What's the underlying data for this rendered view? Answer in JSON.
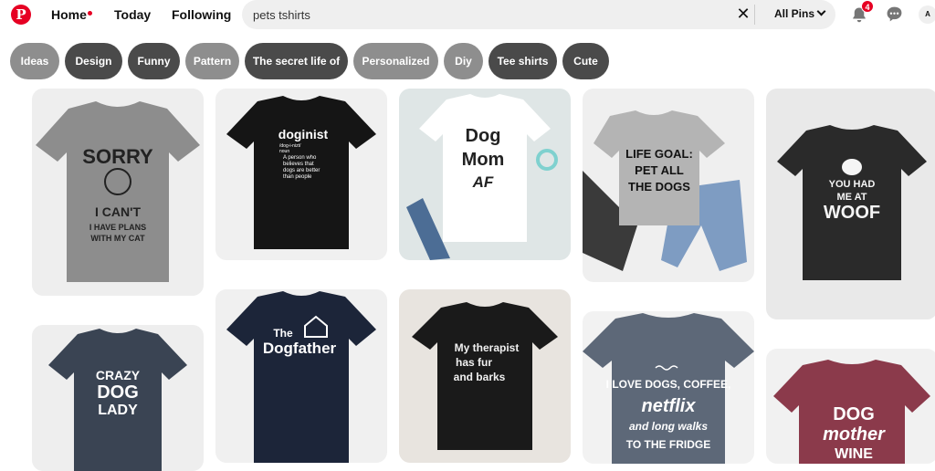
{
  "header": {
    "logo_letter": "P",
    "nav": {
      "home": "Home",
      "today": "Today",
      "following": "Following"
    },
    "search": {
      "value": "pets tshirts",
      "filter_label": "All Pins"
    },
    "notifications_count": "4",
    "avatar_letter": "A",
    "brand_color": "#e60023"
  },
  "chips": [
    {
      "label": "Ideas",
      "color": "#8e8e8e"
    },
    {
      "label": "Design",
      "color": "#4a4a4a"
    },
    {
      "label": "Funny",
      "color": "#4a4a4a"
    },
    {
      "label": "Pattern",
      "color": "#8e8e8e"
    },
    {
      "label": "The secret life of",
      "color": "#4a4a4a"
    },
    {
      "label": "Personalized",
      "color": "#8e8e8e"
    },
    {
      "label": "Diy",
      "color": "#8e8e8e"
    },
    {
      "label": "Tee shirts",
      "color": "#4a4a4a"
    },
    {
      "label": "Cute",
      "color": "#4a4a4a"
    }
  ],
  "pins": [
    {
      "print": [
        "SORRY",
        "I CAN'T",
        "I HAVE PLANS",
        "WITH MY CAT"
      ],
      "shirt_color": "#8d8d8d",
      "ink": "#222222",
      "bg": "#eeeeee"
    },
    {
      "print": [
        "doginist",
        "/dog-i-nizt/",
        "noun",
        "A person who",
        "believes that",
        "dogs are better",
        "than people"
      ],
      "shirt_color": "#151515",
      "ink": "#ffffff",
      "bg": "#f0f0f0"
    },
    {
      "print": [
        "Dog",
        "Mom",
        "AF"
      ],
      "shirt_color": "#ffffff",
      "ink": "#222222",
      "bg": "#dfe6e6"
    },
    {
      "print": [
        "LIFE GOAL:",
        "PET ALL",
        "THE DOGS"
      ],
      "shirt_color": "#b4b4b4",
      "ink": "#111111",
      "bg": "#efefef"
    },
    {
      "print": [
        "YOU HAD",
        "ME AT",
        "WOOF"
      ],
      "shirt_color": "#2a2a2a",
      "ink": "#f5f5f5",
      "bg": "#e9e9e9"
    },
    {
      "print": [
        "CRAZY",
        "DOG",
        "LADY"
      ],
      "shirt_color": "#3a4453",
      "ink": "#ffffff",
      "bg": "#eeeeee"
    },
    {
      "print": [
        "The",
        "Dogfather"
      ],
      "shirt_color": "#1c2539",
      "ink": "#ffffff",
      "bg": "#f0f0f0"
    },
    {
      "print": [
        "My therapist",
        "has fur",
        "and barks"
      ],
      "shirt_color": "#1a1a1a",
      "ink": "#f0f0f0",
      "bg": "#e8e4df"
    },
    {
      "print": [
        "I LOVE DOGS, COFFEE,",
        "netflix",
        "and long walks",
        "TO THE FRIDGE"
      ],
      "shirt_color": "#5d6878",
      "ink": "#ffffff",
      "bg": "#f2f2f2"
    },
    {
      "print": [
        "DOG",
        "mother",
        "WINE"
      ],
      "shirt_color": "#8b3a4b",
      "ink": "#ffffff",
      "bg": "#f1f1f1"
    }
  ]
}
